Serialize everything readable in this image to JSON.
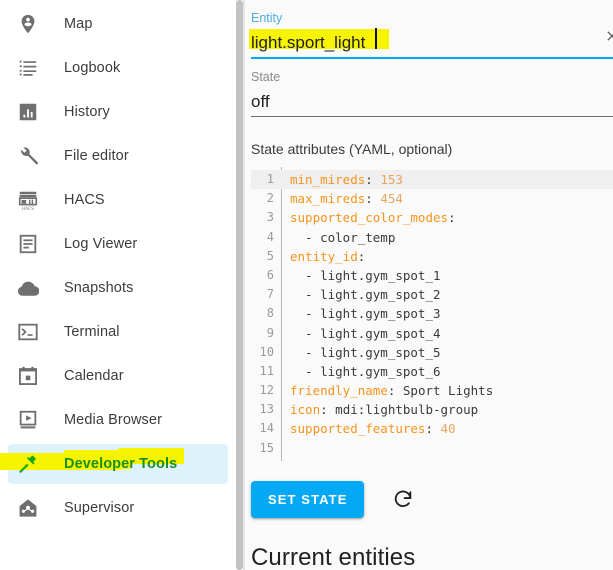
{
  "sidebar": {
    "items": [
      {
        "label": "Map",
        "icon": "map-marker-person-icon",
        "selected": false
      },
      {
        "label": "Logbook",
        "icon": "logbook-list-icon",
        "selected": false
      },
      {
        "label": "History",
        "icon": "history-chart-icon",
        "selected": false
      },
      {
        "label": "File editor",
        "icon": "wrench-icon",
        "selected": false
      },
      {
        "label": "HACS",
        "icon": "hacs-store-icon",
        "selected": false
      },
      {
        "label": "Log Viewer",
        "icon": "document-lines-icon",
        "selected": false
      },
      {
        "label": "Snapshots",
        "icon": "cloud-icon",
        "selected": false
      },
      {
        "label": "Terminal",
        "icon": "terminal-prompt-icon",
        "selected": false
      },
      {
        "label": "Calendar",
        "icon": "calendar-icon",
        "selected": false
      },
      {
        "label": "Media Browser",
        "icon": "media-play-icon",
        "selected": false
      },
      {
        "label": "Developer Tools",
        "icon": "hammer-icon",
        "selected": true
      },
      {
        "label": "Supervisor",
        "icon": "supervisor-home-icon",
        "selected": false
      }
    ],
    "selected_accent": "#1a8f1a",
    "selected_row_bg": "#ddf2fb",
    "marker_color": "#f6f400"
  },
  "main": {
    "entity": {
      "label": "Entity",
      "value": "light.sport_light",
      "placeholder": "Entity",
      "clear_icon": "close-icon",
      "accent": "#03a9f4"
    },
    "state": {
      "label": "State",
      "value": "off",
      "placeholder": "State"
    },
    "attributes": {
      "label": "State attributes (YAML, optional)",
      "lines": [
        {
          "n": "1",
          "key": "min_mireds",
          "sep": ": ",
          "value": "153",
          "value_type": "num",
          "active": true
        },
        {
          "n": "2",
          "key": "max_mireds",
          "sep": ": ",
          "value": "454",
          "value_type": "num",
          "active": false
        },
        {
          "n": "3",
          "key": "supported_color_modes",
          "sep": ":",
          "value": "",
          "value_type": "plain",
          "active": false
        },
        {
          "n": "4",
          "key": "",
          "sep": "",
          "value": "  - color_temp",
          "value_type": "plain",
          "active": false
        },
        {
          "n": "5",
          "key": "entity_id",
          "sep": ":",
          "value": "",
          "value_type": "plain",
          "active": false
        },
        {
          "n": "6",
          "key": "",
          "sep": "",
          "value": "  - light.gym_spot_1",
          "value_type": "plain",
          "active": false
        },
        {
          "n": "7",
          "key": "",
          "sep": "",
          "value": "  - light.gym_spot_2",
          "value_type": "plain",
          "active": false
        },
        {
          "n": "8",
          "key": "",
          "sep": "",
          "value": "  - light.gym_spot_3",
          "value_type": "plain",
          "active": false
        },
        {
          "n": "9",
          "key": "",
          "sep": "",
          "value": "  - light.gym_spot_4",
          "value_type": "plain",
          "active": false
        },
        {
          "n": "10",
          "key": "",
          "sep": "",
          "value": "  - light.gym_spot_5",
          "value_type": "plain",
          "active": false
        },
        {
          "n": "11",
          "key": "",
          "sep": "",
          "value": "  - light.gym_spot_6",
          "value_type": "plain",
          "active": false
        },
        {
          "n": "12",
          "key": "friendly_name",
          "sep": ": ",
          "value": "Sport Lights",
          "value_type": "plain",
          "active": false
        },
        {
          "n": "13",
          "key": "icon",
          "sep": ": ",
          "value": "mdi:lightbulb-group",
          "value_type": "plain",
          "active": false
        },
        {
          "n": "14",
          "key": "supported_features",
          "sep": ": ",
          "value": "40",
          "value_type": "num",
          "active": false
        },
        {
          "n": "15",
          "key": "",
          "sep": "",
          "value": "",
          "value_type": "plain",
          "active": false
        }
      ]
    },
    "set_state_button": "SET STATE",
    "refresh_icon": "refresh-icon",
    "current_entities_title": "Current entities"
  }
}
